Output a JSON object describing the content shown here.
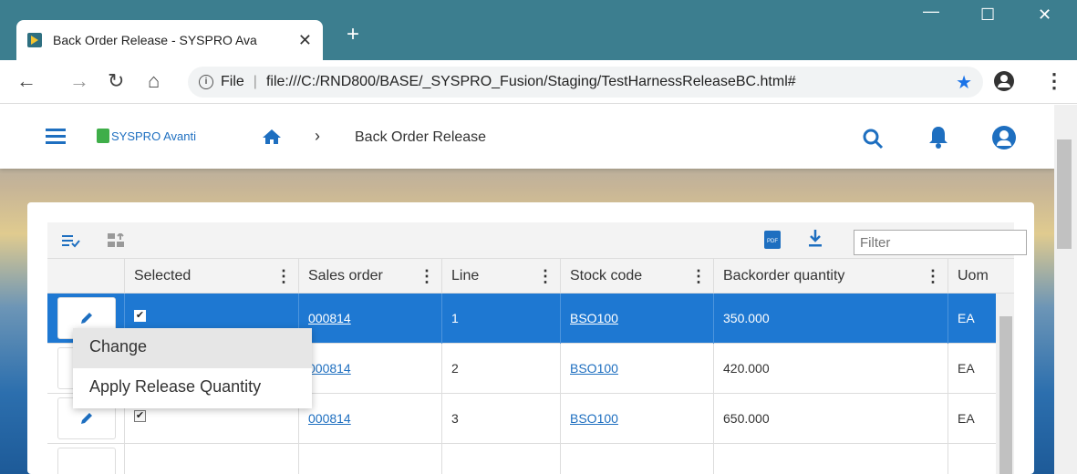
{
  "browser": {
    "tab_title": "Back Order Release - SYSPRO Ava",
    "tab_close": "✕",
    "new_tab": "+",
    "url_scheme_label": "File",
    "url": "file:///C:/RND800/BASE/_SYSPRO_Fusion/Staging/TestHarnessReleaseBC.html#"
  },
  "app": {
    "logo_text": "SYSPRO Avanti",
    "breadcrumb": "Back Order Release"
  },
  "toolbar": {
    "filter_placeholder": "Filter"
  },
  "grid": {
    "columns": [
      "Selected",
      "Sales order",
      "Line",
      "Stock code",
      "Backorder quantity",
      "Uom"
    ],
    "rows": [
      {
        "selected": true,
        "sales_order": "000814",
        "line": "1",
        "stock_code": "BSO100",
        "backorder_qty": "350.000",
        "uom": "EA"
      },
      {
        "selected": true,
        "sales_order": "000814",
        "line": "2",
        "stock_code": "BSO100",
        "backorder_qty": "420.000",
        "uom": "EA"
      },
      {
        "selected": true,
        "sales_order": "000814",
        "line": "3",
        "stock_code": "BSO100",
        "backorder_qty": "650.000",
        "uom": "EA"
      }
    ]
  },
  "context_menu": {
    "items": [
      "Change",
      "Apply Release Quantity"
    ]
  },
  "colors": {
    "accent": "#1e78d2",
    "titlebar": "#3c7e8f"
  }
}
